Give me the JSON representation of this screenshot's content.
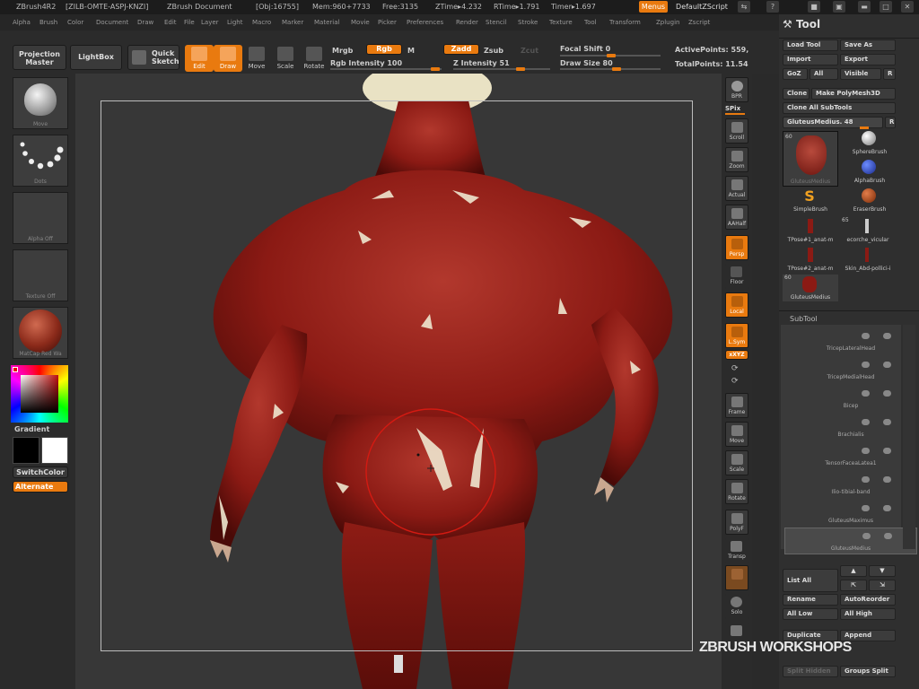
{
  "titlebar": {
    "app": "ZBrush4R2",
    "serial": "[ZILB-OMTE-ASPJ-KNZI]",
    "doc": "ZBrush Document",
    "obj": "[Obj:16755]",
    "mem": "Mem:960+7733",
    "free": "Free:3135",
    "ztime": "ZTime▸4.232",
    "rtime": "RTime▸1.791",
    "timer": "Timer▸1.697",
    "menus_btn": "Menus",
    "script_btn": "DefaultZScript"
  },
  "menubar": [
    "Alpha",
    "Brush",
    "Color",
    "Document",
    "Draw",
    "Edit",
    "File",
    "Layer",
    "Light",
    "Macro",
    "Marker",
    "Material",
    "Movie",
    "Picker",
    "Preferences",
    "Render",
    "Stencil",
    "Stroke",
    "Texture",
    "Tool",
    "Transform",
    "Zplugin",
    "Zscript"
  ],
  "shelf": {
    "projection_master": "Projection Master",
    "lightbox": "LightBox",
    "quick_sketch": "Quick Sketch",
    "edit": "Edit",
    "draw": "Draw",
    "move": "Move",
    "scale": "Scale",
    "rotate": "Rotate",
    "mrgb": "Mrgb",
    "rgb": "Rgb",
    "m": "M",
    "rgb_intensity": "Rgb Intensity 100",
    "zadd": "Zadd",
    "zsub": "Zsub",
    "zcut": "Zcut",
    "z_intensity": "Z Intensity 51",
    "focal_shift": "Focal Shift 0",
    "draw_size": "Draw Size 80",
    "active_points": "ActivePoints: 559,",
    "total_points": "TotalPoints: 11.54"
  },
  "leftshelf": {
    "brush_caption": "Move",
    "stroke_caption": "Dots",
    "alpha_caption": "Alpha Off",
    "texture_caption": "Texture Off",
    "material_caption": "MatCap Red Wa",
    "gradient": "Gradient",
    "switch_color": "SwitchColor",
    "alternate": "Alternate"
  },
  "rightshelf": [
    "BPR",
    "SPix",
    "Scroll",
    "Zoom",
    "Actual",
    "AAHalf",
    "Persp",
    "Floor",
    "Local",
    "L.Sym",
    "xXYZ",
    "",
    "",
    "Frame",
    "Move",
    "Scale",
    "Rotate",
    "PolyF",
    "Transp",
    "",
    "Solo",
    ""
  ],
  "tool": {
    "title": "Tool",
    "load_tool": "Load Tool",
    "save_as": "Save As",
    "import": "Import",
    "export": "Export",
    "goz": "GoZ",
    "all": "All",
    "visible": "Visible",
    "r": "R",
    "clone": "Clone",
    "make_polymesh": "Make PolyMesh3D",
    "clone_all": "Clone All SubTools",
    "current": "GluteusMedius. 48",
    "current_r": "R",
    "thumbs": [
      {
        "label": "GluteusMedius",
        "count": "60"
      },
      {
        "label": "SphereBrush",
        "count": ""
      },
      {
        "label": "AlphaBrush",
        "count": ""
      },
      {
        "label": "SimpleBrush",
        "count": ""
      },
      {
        "label": "EraserBrush",
        "count": ""
      },
      {
        "label": "TPose#1_anat-m",
        "count": "65"
      },
      {
        "label": "ecorche_vicular",
        "count": ""
      },
      {
        "label": "TPose#2_anat-m",
        "count": ""
      },
      {
        "label": "Skin_Abd-pollici-i",
        "count": ""
      },
      {
        "label": "GluteusMedius",
        "count": "60"
      }
    ],
    "subtool_title": "SubTool",
    "subtools": [
      "TricepLateralHead",
      "TricepMedialHead",
      "Bicep",
      "Brachialis",
      "TensorFaceaLatea1",
      "Ilio-tibial-band",
      "GluteusMaximus",
      "GluteusMedius"
    ],
    "list_all": "List All",
    "rename": "Rename",
    "autoreorder": "AutoReorder",
    "all_low": "All Low",
    "all_high": "All High",
    "duplicate": "Duplicate",
    "append": "Append",
    "split_hidden": "Split Hidden",
    "groups_split": "Groups Split"
  },
  "watermark": "ZBRUSH WORKSHOPS",
  "colors": {
    "accent": "#e97a0f",
    "muscle": "#8b1a14",
    "bg": "#373737"
  }
}
